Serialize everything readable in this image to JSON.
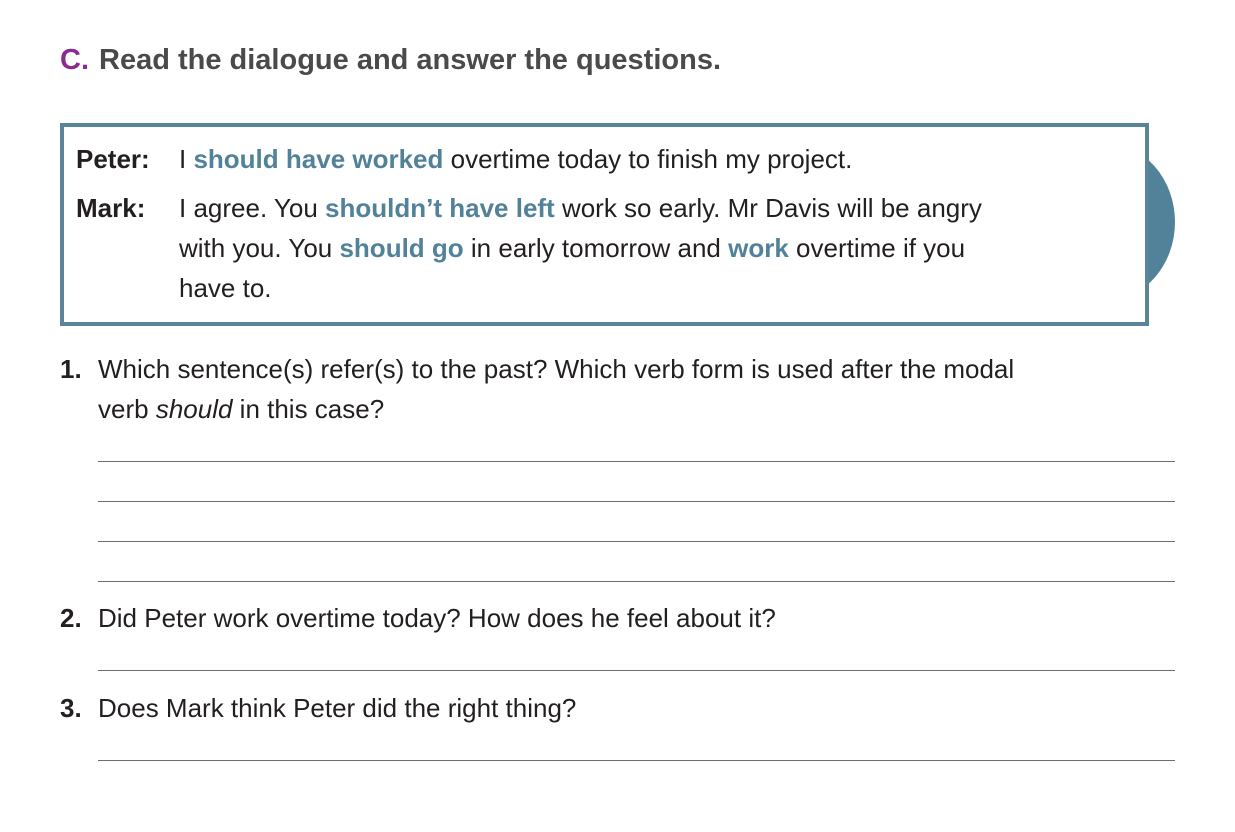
{
  "heading": {
    "letter": "C.",
    "title": "Read the dialogue and answer the questions."
  },
  "dialogue": {
    "peter": {
      "speaker": "Peter:",
      "l1_a": "I ",
      "l1_b": "should have worked",
      "l1_c": " overtime today to finish my project."
    },
    "mark": {
      "speaker": "Mark:",
      "l1_a": "I agree. You ",
      "l1_b": "shouldn’t have left",
      "l1_c": " work so early. Mr Davis will be angry",
      "l2_a": "with you. You ",
      "l2_b": "should go",
      "l2_c": " in early tomorrow and ",
      "l2_d": "work",
      "l2_e": " overtime if you",
      "l3": "have to."
    }
  },
  "questions": [
    {
      "number": "1.",
      "line1": "Which sentence(s) refer(s) to the past? Which verb form is used after the modal",
      "line2_a": "verb ",
      "line2_b": "should",
      "line2_c": " in this case?"
    },
    {
      "number": "2.",
      "text": "Did Peter work overtime today? How does he feel about it?"
    },
    {
      "number": "3.",
      "text": "Does Mark think Peter did the right thing?"
    }
  ],
  "colors": {
    "highlight": "#52829a",
    "heading_letter": "#8a2b8f",
    "box_border": "#5a8599"
  }
}
